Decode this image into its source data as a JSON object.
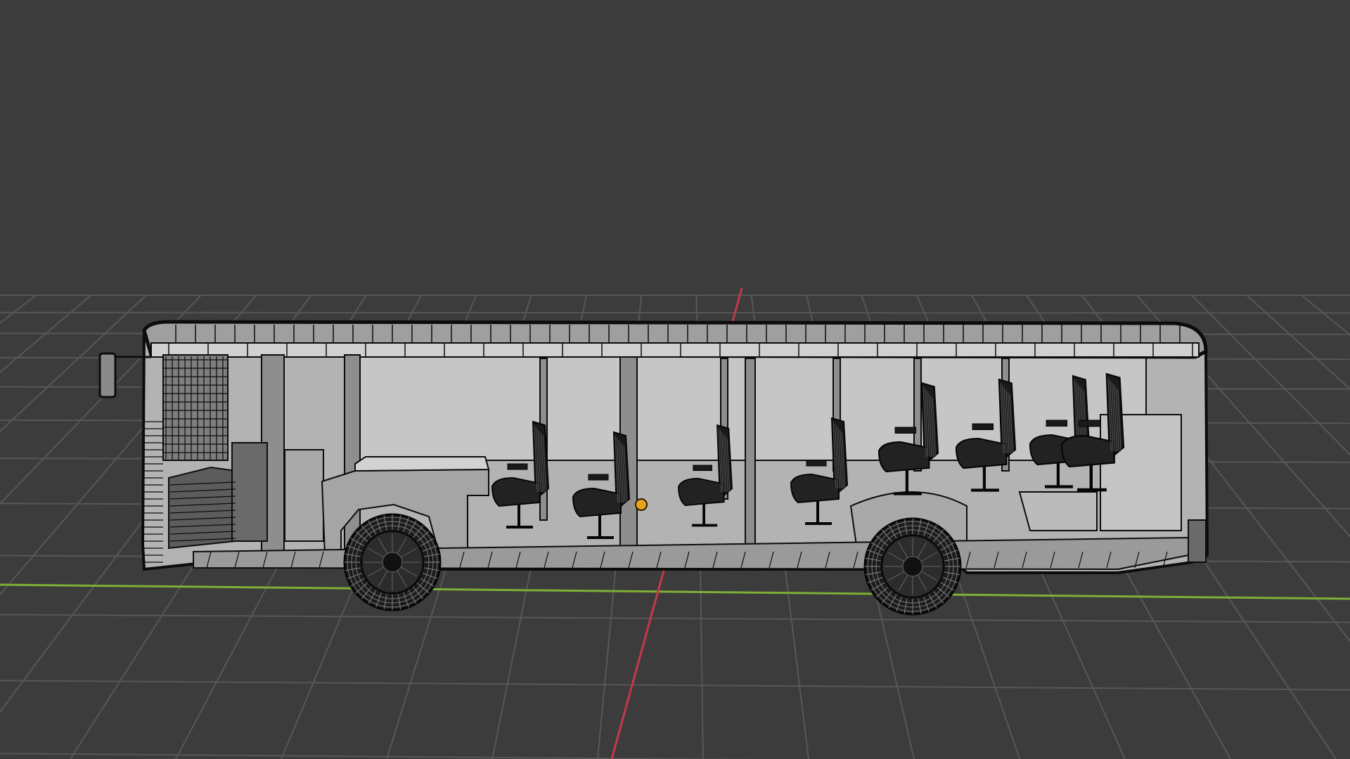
{
  "viewport": {
    "mode": "wireframe",
    "background_color": "#3c3c3c",
    "grid_color": "#575757",
    "x_axis_color": "#7fae37",
    "y_axis_color": "#c2394c",
    "object_wire_color": "#0c0c0c",
    "object_fill_color": "#b8b8b8",
    "origin_color": "#e8a21c"
  },
  "scene": {
    "object": "bus-wireframe-model",
    "object_parts": [
      "body-shell",
      "roof",
      "front-wheel",
      "rear-wheel",
      "passenger-seats",
      "driver-seat",
      "side-mirror",
      "wheel-arches",
      "floor",
      "window-pillars"
    ],
    "seat_count": 8
  }
}
